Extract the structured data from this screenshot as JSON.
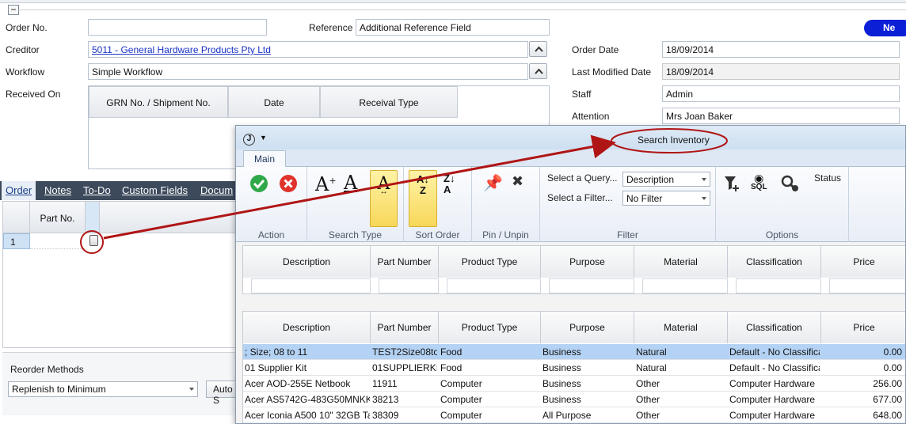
{
  "order_form": {
    "order_no_label": "Order No.",
    "order_no_value": "",
    "reference_label": "Reference",
    "reference_value": "Additional Reference Field",
    "creditor_label": "Creditor",
    "creditor_value": "5011 - General Hardware Products Pty Ltd",
    "workflow_label": "Workflow",
    "workflow_value": "Simple Workflow",
    "received_on_label": "Received On",
    "received_grid_headers": [
      "GRN No. / Shipment No.",
      "Date",
      "Receival Type"
    ],
    "order_date_label": "Order Date",
    "order_date_value": "18/09/2014",
    "last_modified_label": "Last Modified Date",
    "last_modified_value": "18/09/2014",
    "staff_label": "Staff",
    "staff_value": "Admin",
    "attention_label": "Attention",
    "attention_value": "Mrs Joan Baker",
    "new_button_label": "Ne",
    "collapse_symbol": "−"
  },
  "tabs": [
    "Order",
    "Notes",
    "To-Do",
    "Custom Fields",
    "Docum"
  ],
  "lines_grid": {
    "part_no_header": "Part No.",
    "row_number": "1"
  },
  "reorder": {
    "label": "Reorder Methods",
    "selected": "Replenish to Minimum",
    "auto_button": "Auto S"
  },
  "popup": {
    "title": "Search Inventory",
    "ribbon_tab": "Main",
    "groups": {
      "action": "Action",
      "search_type": "Search Type",
      "sort_order": "Sort Order",
      "pin_unpin": "Pin / Unpin",
      "filter": "Filter",
      "options": "Options"
    },
    "select_query_label": "Select a Query...",
    "select_query_value": "Description",
    "select_filter_label": "Select a Filter...",
    "select_filter_value": "No Filter",
    "status_label": "Status",
    "sql_label": "SQL",
    "columns": [
      "Description",
      "Part Number",
      "Product Type",
      "Purpose",
      "Material",
      "Classification",
      "Price"
    ],
    "rows": [
      [
        "; Size; 08 to 11",
        "TEST2Size08to1",
        "Food",
        "Business",
        "Natural",
        "Default - No Classificatio",
        "0.00"
      ],
      [
        "01 Supplier Kit",
        "01SUPPLIERKIT",
        "Food",
        "Business",
        "Natural",
        "Default - No Classificatio",
        "0.00"
      ],
      [
        "Acer AOD-255E Netbook",
        "11911",
        "Computer",
        "Business",
        "Other",
        "Computer Hardware",
        "256.00"
      ],
      [
        "Acer AS5742G-483G50MNKK 15",
        "38213",
        "Computer",
        "Business",
        "Other",
        "Computer Hardware",
        "677.00"
      ],
      [
        "Acer Iconia A500 10\" 32GB Tabl",
        "38309",
        "Computer",
        "All Purpose",
        "Other",
        "Computer Hardware",
        "648.00"
      ]
    ]
  },
  "colors": {
    "accent_blue": "#0a1fd6",
    "callout_red": "#b01515",
    "tabbar_dark": "#3c4a5c",
    "selected_row": "#b4d2f3",
    "highlight_yellow": "#f8d75a"
  }
}
